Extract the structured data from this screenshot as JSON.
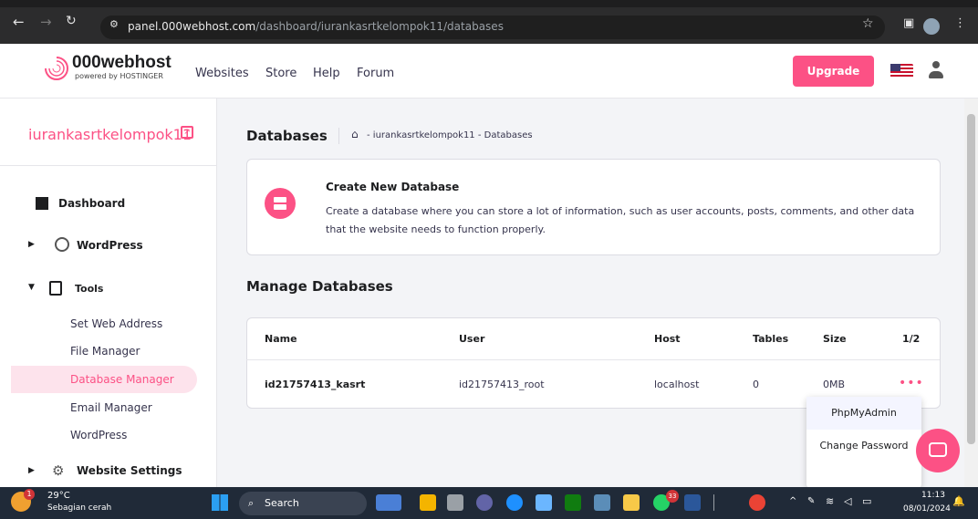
{
  "browser": {
    "url_host": "panel.000webhost.com",
    "url_path": "/dashboard/iurankasrtkelompok11/databases"
  },
  "header": {
    "brand": "000webhost",
    "brand_sub": "powered by HOSTINGER",
    "nav": [
      "Websites",
      "Store",
      "Help",
      "Forum"
    ],
    "upgrade_label": "Upgrade"
  },
  "sidebar": {
    "site_name": "iurankasrtkelompok11",
    "items": [
      {
        "label": "Dashboard"
      },
      {
        "label": "WordPress"
      },
      {
        "label": "Tools"
      },
      {
        "label": "Website Settings"
      }
    ],
    "tools_sub": [
      "Set Web Address",
      "File Manager",
      "Database Manager",
      "Email Manager",
      "WordPress"
    ]
  },
  "main": {
    "title": "Databases",
    "breadcrumb": "- iurankasrtkelompok11 - Databases",
    "create_card": {
      "title": "Create New Database",
      "desc": "Create a database where you can store a lot of information, such as user accounts, posts, comments, and other data that the website needs to function properly."
    },
    "manage_title": "Manage Databases",
    "table": {
      "headers": [
        "Name",
        "User",
        "Host",
        "Tables",
        "Size",
        "1/2"
      ],
      "rows": [
        [
          "id21757413_kasrt",
          "id21757413_root",
          "localhost",
          "0",
          "0MB"
        ]
      ]
    },
    "dropdown": [
      "PhpMyAdmin",
      "Change Password"
    ]
  },
  "taskbar": {
    "temp": "29°C",
    "weather": "Sebagian cerah",
    "search": "Search",
    "badge1": "1",
    "badge33": "33",
    "time": "11:13",
    "date": "08/01/2024"
  },
  "colors": {
    "accent": "#fc5185",
    "browser": "#2c2c2d",
    "taskbar": "#202a38"
  }
}
